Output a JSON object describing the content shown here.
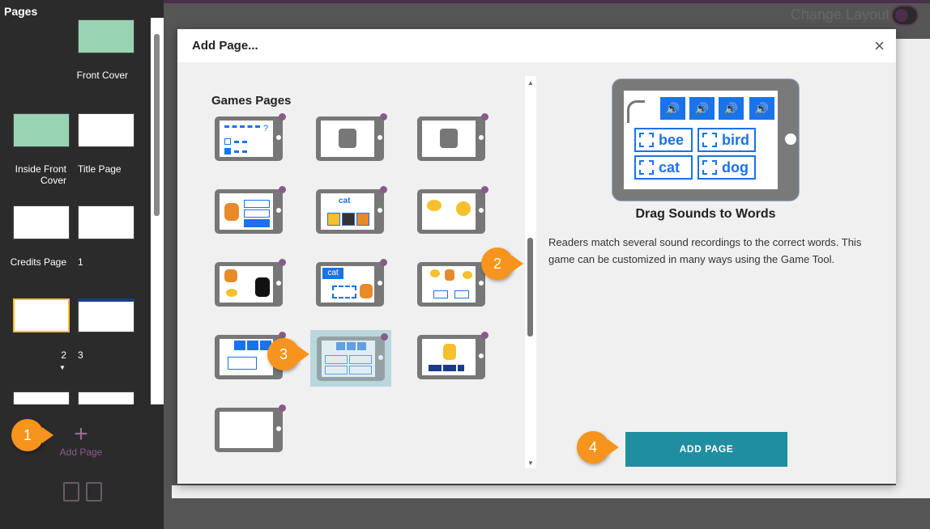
{
  "left": {
    "title": "Pages",
    "thumbs": [
      "Front Cover",
      "Inside Front Cover",
      "Title Page",
      "Credits Page",
      "1",
      "2",
      "3"
    ],
    "add_page": "Add Page"
  },
  "topbar": {
    "change_layout": "Change Layout"
  },
  "dialog": {
    "title": "Add Page...",
    "close": "×",
    "section": "Games Pages",
    "preview": {
      "title": "Drag Sounds to Words",
      "description": "Readers match several sound recordings to the correct words. This game can be customized in many ways using the Game Tool.",
      "words": [
        "bee",
        "bird",
        "cat",
        "dog"
      ]
    },
    "add_button": "ADD PAGE"
  },
  "callouts": [
    "1",
    "2",
    "3",
    "4"
  ],
  "colors": {
    "accent": "#1f8ea0",
    "callout": "#f7941d",
    "selected": "#f5c02c"
  }
}
